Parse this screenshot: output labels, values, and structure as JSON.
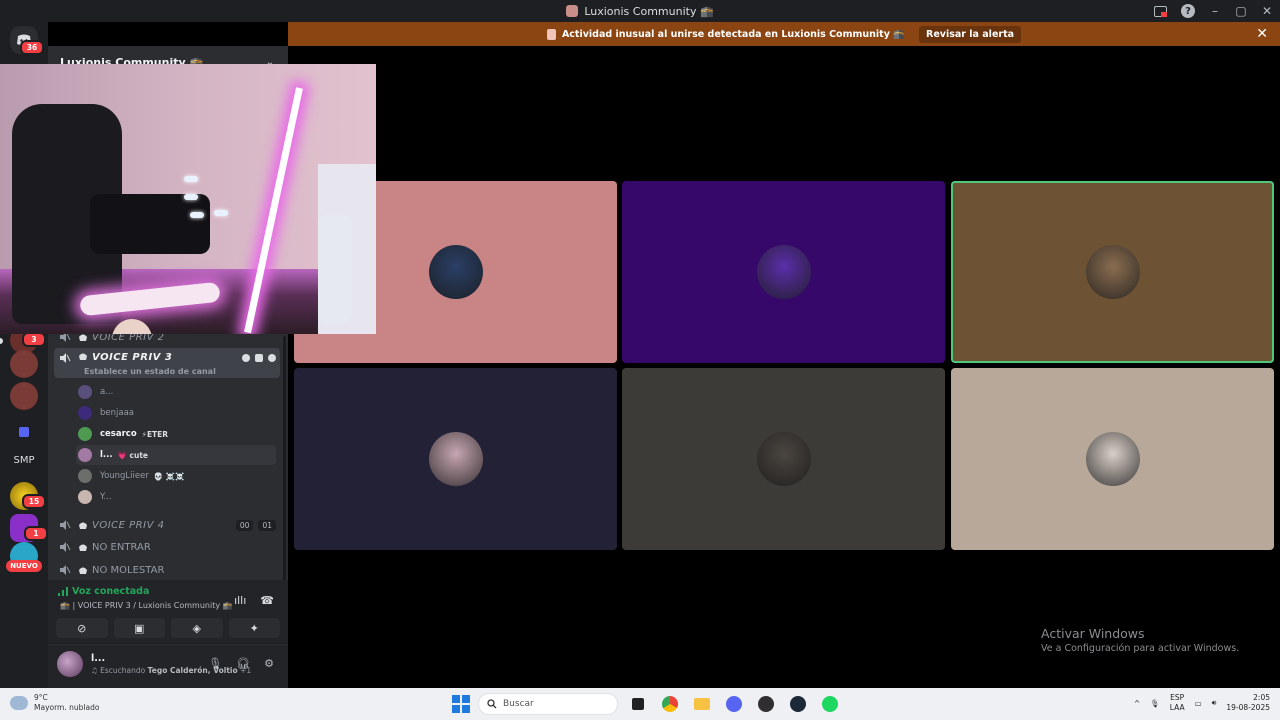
{
  "window": {
    "title": "Luxionis Community 🕋"
  },
  "alert": {
    "message": "Actividad inusual al unirse detectada en Luxionis Community 🕋",
    "action_label": "Revisar la alerta",
    "close_label": "✕"
  },
  "rail": {
    "home_badge": "36",
    "badges": [
      "3",
      "15",
      "1"
    ],
    "smp_label": "SMP",
    "nuevo_label": "NUEVO"
  },
  "server": {
    "name": "Luxionis Community 🕋"
  },
  "channels": {
    "voice_priv_2": "VOICE PRIV 2",
    "voice_priv_3": "VOICE PRIV 3",
    "voice_priv_3_status": "Establece un estado de canal",
    "voice_priv_4": "VOICE PRIV 4",
    "voice_priv_4_counts": [
      "00",
      "01"
    ],
    "no_entrar": "NO ENTRAR",
    "no_molestar": "NO MOLESTAR"
  },
  "members": [
    {
      "name": "a...",
      "tag": "",
      "color": "#5a4f7a"
    },
    {
      "name": "benjaaa",
      "tag": "",
      "color": "#3d2a7a"
    },
    {
      "name": "cesarco",
      "tag": "⚡ETER",
      "color": "#4e9a52"
    },
    {
      "name": "l...",
      "tag": "💗 cute",
      "color": "#a27aa4"
    },
    {
      "name": "YoungLiieer",
      "tag": "💀 ☠️☠️",
      "color": "#6b6e6a"
    },
    {
      "name": "Y...",
      "tag": "",
      "color": "#c9b5b0"
    }
  ],
  "voice_panel": {
    "status": "Voz conectada",
    "channel": "🕋 | VOICE PRIV 3 / Luxionis Community 🕋"
  },
  "user_panel": {
    "name": "l...",
    "activity_prefix": "Escuchando",
    "activity": "Tego Calderón, Voltio",
    "activity_suffix": "+1"
  },
  "tiles": [
    {
      "bg": "#c98585",
      "avatar": "#2a3f66",
      "speaking": false
    },
    {
      "bg": "#36086a",
      "avatar": "#5a2ea8",
      "speaking": false
    },
    {
      "bg": "#6e5234",
      "avatar": "#8a6d50",
      "speaking": true
    },
    {
      "bg": "#222136",
      "avatar": "#c7a6b2",
      "speaking": false
    },
    {
      "bg": "#3d3b37",
      "avatar": "#4a4540",
      "speaking": false
    },
    {
      "bg": "#b8a89a",
      "avatar": "#d9cfc8",
      "speaking": false
    }
  ],
  "watermark": {
    "line1": "Activar Windows",
    "line2": "Ve a Configuración para activar Windows."
  },
  "taskbar": {
    "temp": "9°C",
    "weather": "Mayorm. nublado",
    "search_placeholder": "Buscar",
    "lang1": "ESP",
    "lang2": "LAA",
    "time": "2:05",
    "date": "19-08-2025"
  }
}
